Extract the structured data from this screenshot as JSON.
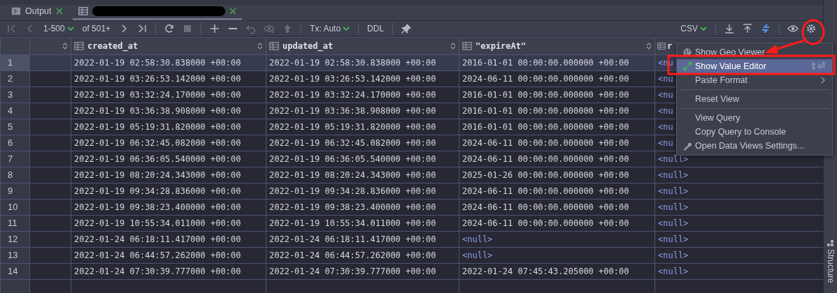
{
  "tabs": [
    {
      "label": "Output",
      "selected": false,
      "kind": "output"
    },
    {
      "selected": true,
      "kind": "table"
    }
  ],
  "toolbar": {
    "page_range": "1-500",
    "row_count": "of 501+",
    "tx_mode": "Tx: Auto",
    "ddl": "DDL",
    "format": "CSV",
    "icon_buttons": [
      {
        "disabled": true
      },
      {
        "disabled": true
      },
      {
        "disabled": false
      },
      {
        "disabled": false
      },
      {
        "disabled": false
      },
      {
        "disabled": true
      },
      {
        "disabled": false
      },
      {
        "disabled": false
      },
      {
        "disabled": true
      },
      {
        "disabled": true
      },
      {
        "disabled": true
      },
      {
        "disabled": false
      }
    ]
  },
  "table": {
    "columns": [
      "created_at",
      "updated_at",
      "\"expireAt\"",
      "r"
    ],
    "rows": [
      {
        "number": "1",
        "selected": true,
        "cells": [
          {
            "text": "2022-01-19 02:58:30.838000 +00:00",
            "kind": "value"
          },
          {
            "text": "2022-01-19 02:58:30.838000 +00:00",
            "kind": "value"
          },
          {
            "text": "2016-01-01 00:00:00.000000 +00:00",
            "kind": "value"
          },
          {
            "text": "<nu",
            "kind": "null"
          }
        ]
      },
      {
        "number": "2",
        "selected": false,
        "cells": [
          {
            "text": "2022-01-19 03:26:53.142000 +00:00",
            "kind": "value"
          },
          {
            "text": "2022-01-19 03:26:53.142000 +00:00",
            "kind": "value"
          },
          {
            "text": "2024-06-11 00:00:00.000000 +00:00",
            "kind": "value"
          },
          {
            "text": "<nu",
            "kind": "null"
          }
        ]
      },
      {
        "number": "3",
        "selected": false,
        "cells": [
          {
            "text": "2022-01-19 03:32:24.170000 +00:00",
            "kind": "value"
          },
          {
            "text": "2022-01-19 03:32:24.170000 +00:00",
            "kind": "value"
          },
          {
            "text": "2016-01-01 00:00:00.000000 +00:00",
            "kind": "value"
          },
          {
            "text": "<nu",
            "kind": "null"
          }
        ]
      },
      {
        "number": "4",
        "selected": false,
        "cells": [
          {
            "text": "2022-01-19 03:36:38.908000 +00:00",
            "kind": "value"
          },
          {
            "text": "2022-01-19 03:36:38.908000 +00:00",
            "kind": "value"
          },
          {
            "text": "2016-01-01 00:00:00.000000 +00:00",
            "kind": "value"
          },
          {
            "text": "<nu",
            "kind": "null"
          }
        ]
      },
      {
        "number": "5",
        "selected": false,
        "cells": [
          {
            "text": "2022-01-19 05:19:31.820000 +00:00",
            "kind": "value"
          },
          {
            "text": "2022-01-19 05:19:31.820000 +00:00",
            "kind": "value"
          },
          {
            "text": "2016-01-01 00:00:00.000000 +00:00",
            "kind": "value"
          },
          {
            "text": "<nu",
            "kind": "null"
          }
        ]
      },
      {
        "number": "6",
        "selected": false,
        "cells": [
          {
            "text": "2022-01-19 06:32:45.082000 +00:00",
            "kind": "value"
          },
          {
            "text": "2022-01-19 06:32:45.082000 +00:00",
            "kind": "value"
          },
          {
            "text": "2024-06-11 00:00:00.000000 +00:00",
            "kind": "value"
          },
          {
            "text": "<nu",
            "kind": "null"
          }
        ]
      },
      {
        "number": "7",
        "selected": false,
        "cells": [
          {
            "text": "2022-01-19 06:36:05.540000 +00:00",
            "kind": "value"
          },
          {
            "text": "2022-01-19 06:36:05.540000 +00:00",
            "kind": "value"
          },
          {
            "text": "2024-06-11 00:00:00.000000 +00:00",
            "kind": "value"
          },
          {
            "text": "<null>",
            "kind": "null"
          }
        ]
      },
      {
        "number": "8",
        "selected": false,
        "cells": [
          {
            "text": "2022-01-19 08:20:24.343000 +00:00",
            "kind": "value"
          },
          {
            "text": "2022-01-19 08:20:24.343000 +00:00",
            "kind": "value"
          },
          {
            "text": "2025-01-26 00:00:00.000000 +00:00",
            "kind": "value"
          },
          {
            "text": "<null>",
            "kind": "null"
          }
        ]
      },
      {
        "number": "9",
        "selected": false,
        "cells": [
          {
            "text": "2022-01-19 09:34:28.836000 +00:00",
            "kind": "value"
          },
          {
            "text": "2022-01-19 09:34:28.836000 +00:00",
            "kind": "value"
          },
          {
            "text": "2024-06-11 00:00:00.000000 +00:00",
            "kind": "value"
          },
          {
            "text": "<null>",
            "kind": "null"
          }
        ]
      },
      {
        "number": "10",
        "selected": false,
        "cells": [
          {
            "text": "2022-01-19 09:38:23.400000 +00:00",
            "kind": "value"
          },
          {
            "text": "2022-01-19 09:38:23.400000 +00:00",
            "kind": "value"
          },
          {
            "text": "2024-06-11 00:00:00.000000 +00:00",
            "kind": "value"
          },
          {
            "text": "<null>",
            "kind": "null"
          }
        ]
      },
      {
        "number": "11",
        "selected": false,
        "cells": [
          {
            "text": "2022-01-19 10:55:34.011000 +00:00",
            "kind": "value"
          },
          {
            "text": "2022-01-19 10:55:34.011000 +00:00",
            "kind": "value"
          },
          {
            "text": "2024-06-11 00:00:00.000000 +00:00",
            "kind": "value"
          },
          {
            "text": "<null>",
            "kind": "null"
          }
        ]
      },
      {
        "number": "12",
        "selected": false,
        "cells": [
          {
            "text": "2022-01-24 06:18:11.417000 +00:00",
            "kind": "value"
          },
          {
            "text": "2022-01-24 06:18:11.417000 +00:00",
            "kind": "value"
          },
          {
            "text": "<null>",
            "kind": "null"
          },
          {
            "text": "<null>",
            "kind": "null"
          }
        ]
      },
      {
        "number": "13",
        "selected": false,
        "cells": [
          {
            "text": "2022-01-24 06:44:57.262000 +00:00",
            "kind": "value"
          },
          {
            "text": "2022-01-24 06:44:57.262000 +00:00",
            "kind": "value"
          },
          {
            "text": "<null>",
            "kind": "null"
          },
          {
            "text": "<null>",
            "kind": "null"
          }
        ]
      },
      {
        "number": "14",
        "selected": false,
        "cells": [
          {
            "text": "2022-01-24 07:30:39.777000 +00:00",
            "kind": "value"
          },
          {
            "text": "2022-01-24 07:30:39.777000 +00:00",
            "kind": "value"
          },
          {
            "text": "2022-01-24 07:45:43.205000 +00:00",
            "kind": "value"
          },
          {
            "text": "<null>",
            "kind": "null"
          }
        ]
      }
    ]
  },
  "context_menu": [
    {
      "kind": "item",
      "label": "Show Geo Viewer",
      "selected": false
    },
    {
      "kind": "item",
      "label": "Show Value Editor",
      "selected": true,
      "shortcut": "⇧⏎"
    },
    {
      "kind": "item",
      "label": "Paste Format",
      "selected": false,
      "submenu": true
    },
    {
      "kind": "separator"
    },
    {
      "kind": "item",
      "label": "Reset View",
      "selected": false
    },
    {
      "kind": "separator"
    },
    {
      "kind": "item",
      "label": "View Query",
      "selected": false
    },
    {
      "kind": "item",
      "label": "Copy Query to Console",
      "selected": false
    },
    {
      "kind": "item",
      "label": "Open Data Views Settings...",
      "selected": false
    }
  ],
  "side_panel": {
    "label": "Structure"
  }
}
